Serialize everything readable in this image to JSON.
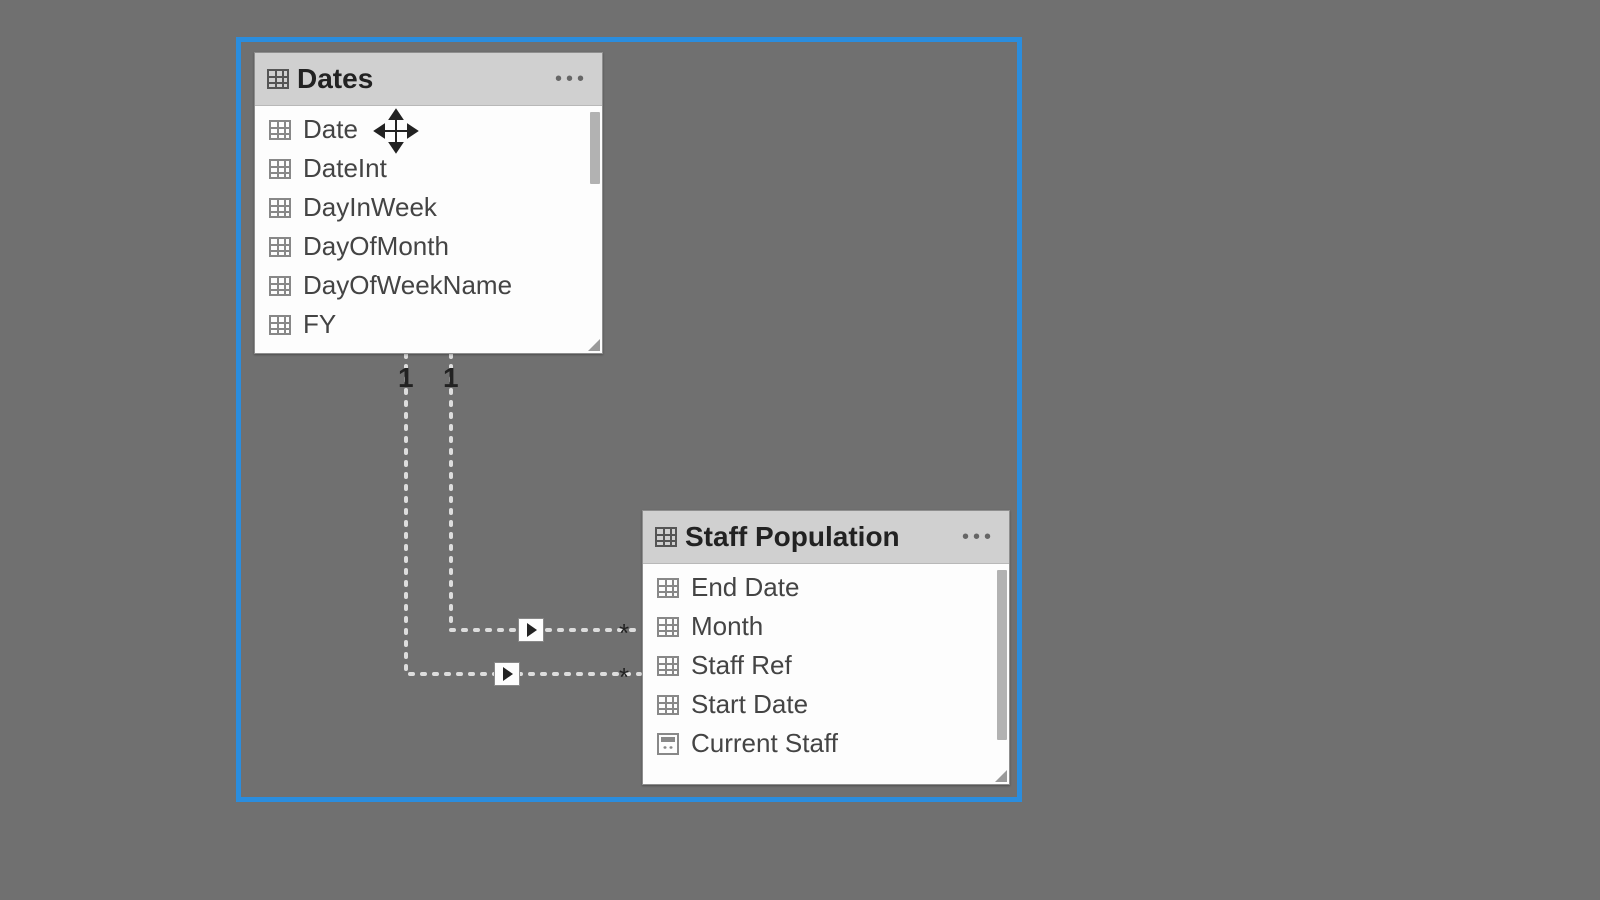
{
  "tables": {
    "dates": {
      "title": "Dates",
      "fields": [
        {
          "name": "Date",
          "icon": "table"
        },
        {
          "name": "DateInt",
          "icon": "table"
        },
        {
          "name": "DayInWeek",
          "icon": "table"
        },
        {
          "name": "DayOfMonth",
          "icon": "table"
        },
        {
          "name": "DayOfWeekName",
          "icon": "table"
        },
        {
          "name": "FY",
          "icon": "table"
        }
      ]
    },
    "staff": {
      "title": "Staff Population",
      "fields": [
        {
          "name": "End Date",
          "icon": "table"
        },
        {
          "name": "Month",
          "icon": "table"
        },
        {
          "name": "Staff Ref",
          "icon": "table"
        },
        {
          "name": "Start Date",
          "icon": "table"
        },
        {
          "name": "Current Staff",
          "icon": "calc"
        }
      ]
    }
  },
  "relationships": {
    "cardinality_one_a": "1",
    "cardinality_one_b": "1",
    "cardinality_many_a": "*",
    "cardinality_many_b": "*"
  }
}
